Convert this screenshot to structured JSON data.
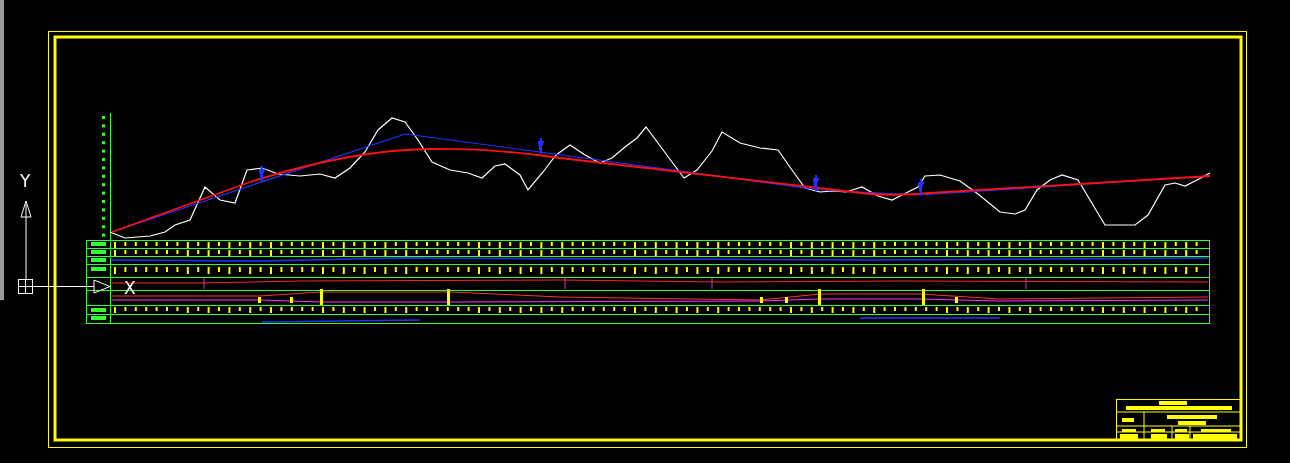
{
  "ucs_icon": {
    "y_label": "Y",
    "x_label": "X"
  }
}
